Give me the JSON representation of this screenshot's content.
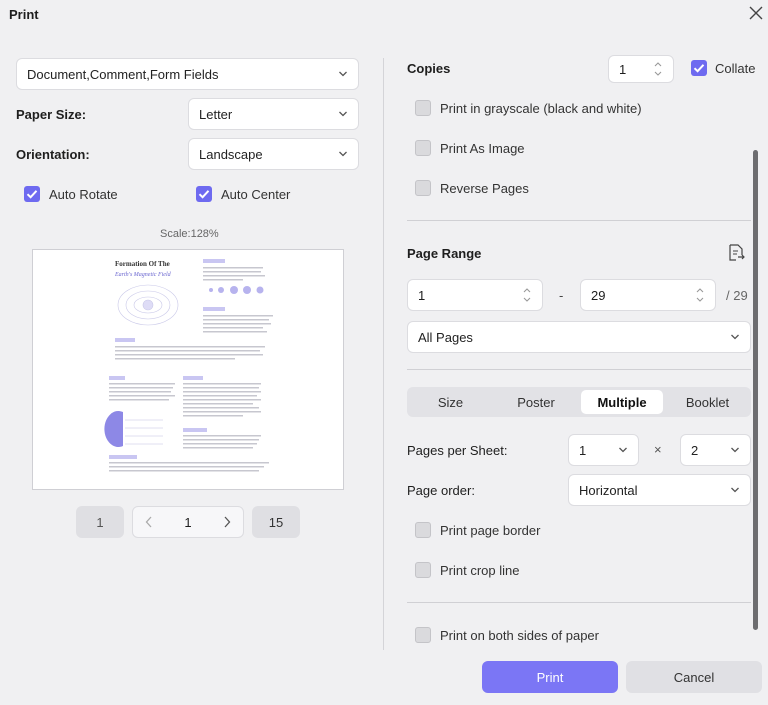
{
  "window": {
    "title": "Print"
  },
  "left": {
    "content_select": "Document,Comment,Form Fields",
    "paper_size_label": "Paper Size:",
    "paper_size_value": "Letter",
    "orientation_label": "Orientation:",
    "orientation_value": "Landscape",
    "auto_rotate": {
      "label": "Auto Rotate",
      "checked": true
    },
    "auto_center": {
      "label": "Auto Center",
      "checked": true
    },
    "scale_text": "Scale:128%",
    "preview": {
      "heading_1": "Formation Of The",
      "heading_2": "Earth's Magnetic Field"
    },
    "pager": {
      "first": "1",
      "current": "1",
      "last": "15"
    }
  },
  "right": {
    "copies_label": "Copies",
    "copies_value": "1",
    "collate": {
      "label": "Collate",
      "checked": true
    },
    "grayscale": {
      "label": "Print in grayscale (black and white)",
      "checked": false
    },
    "as_image": {
      "label": "Print As Image",
      "checked": false
    },
    "reverse": {
      "label": "Reverse Pages",
      "checked": false
    },
    "page_range_label": "Page Range",
    "range_from": "1",
    "range_dash": "-",
    "range_to": "29",
    "range_total": "/ 29",
    "range_select": "All Pages",
    "tabs": [
      "Size",
      "Poster",
      "Multiple",
      "Booklet"
    ],
    "active_tab": "Multiple",
    "pages_per_sheet_label": "Pages per Sheet:",
    "pps_rows": "1",
    "pps_x": "×",
    "pps_cols": "2",
    "page_order_label": "Page order:",
    "page_order_value": "Horizontal",
    "page_border": {
      "label": "Print page border",
      "checked": false
    },
    "crop_line": {
      "label": "Print crop line",
      "checked": false
    },
    "both_sides": {
      "label": "Print on both sides of paper",
      "checked": false
    }
  },
  "footer": {
    "print": "Print",
    "cancel": "Cancel"
  },
  "colors": {
    "accent": "#7b76f5",
    "checkbox_on": "#6e6af0"
  }
}
